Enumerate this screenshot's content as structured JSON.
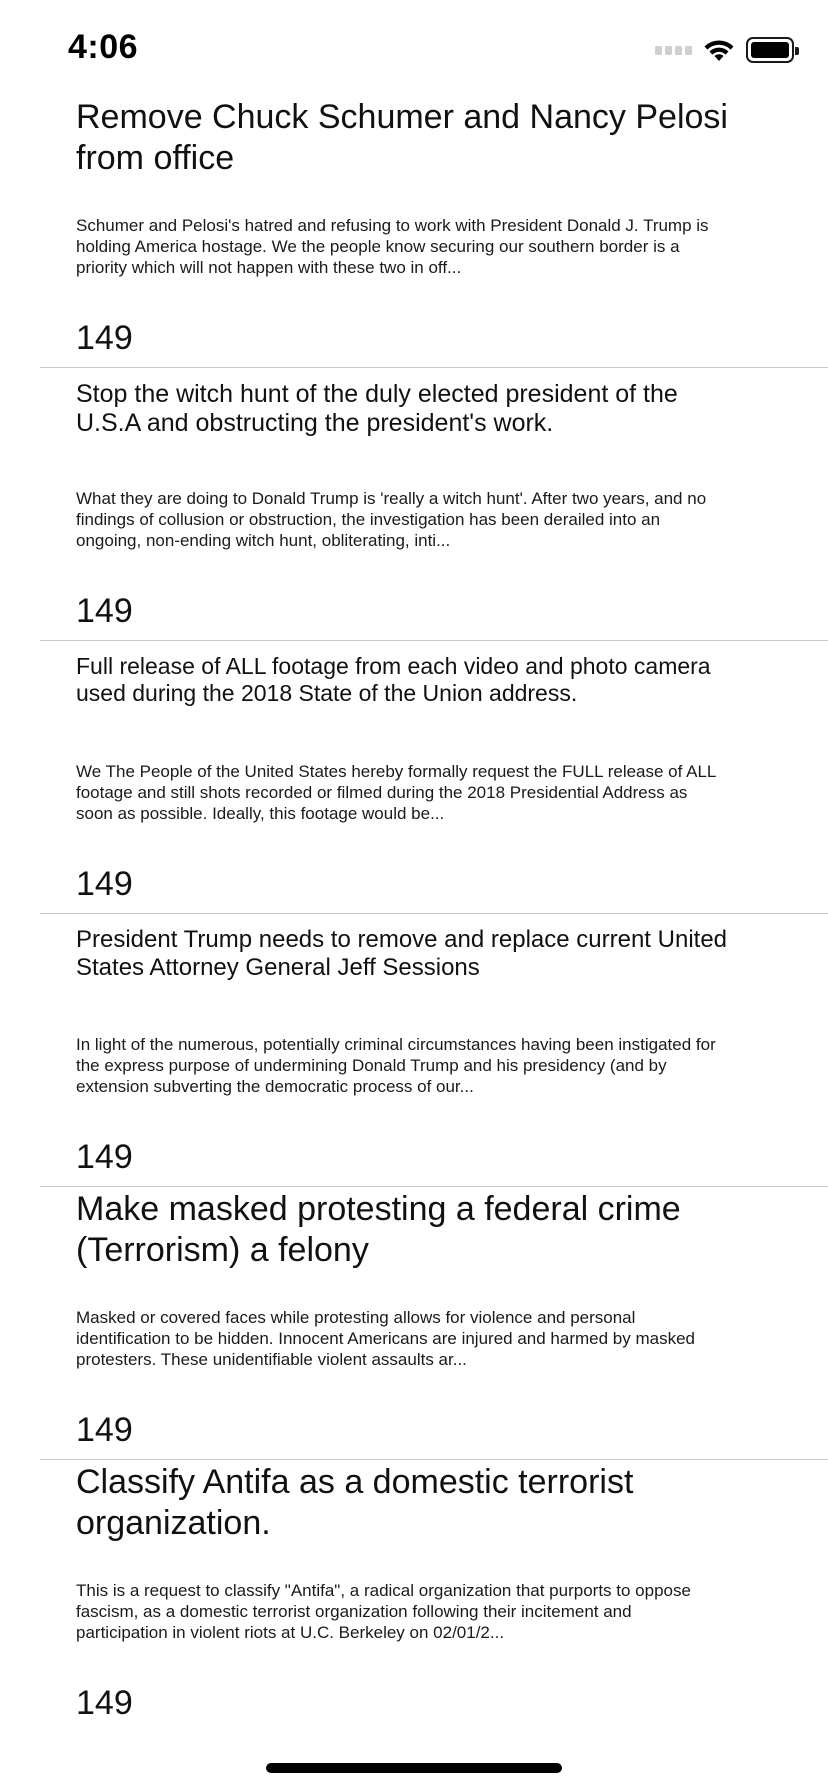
{
  "status_bar": {
    "time": "4:06",
    "icons": [
      "cellular-signal-icon",
      "wifi-icon",
      "battery-icon"
    ]
  },
  "petitions": [
    {
      "title": "Remove Chuck Schumer and Nancy Pelosi from office",
      "body": "Schumer and Pelosi's hatred and refusing to work with President Donald J. Trump is holding America hostage. We the people know securing our southern border is a priority which will not happen with these two in off...",
      "count": "149"
    },
    {
      "title": "Stop the witch hunt of the duly elected president of the U.S.A  and obstructing the president's work.",
      "body": "What they are doing to Donald Trump is 'really a witch hunt'.  After two years, and no findings of collusion or obstruction, the investigation has been derailed into an ongoing, non-ending witch hunt, obliterating,  inti...",
      "count": "149"
    },
    {
      "title": "Full release of ALL footage from each video and photo camera used during the 2018 State of the Union address.",
      "body": "We The People of the United States hereby formally request the FULL release of ALL footage and still shots recorded or filmed during the 2018 Presidential Address as soon as possible. Ideally, this footage would be...",
      "count": "149"
    },
    {
      "title": "President Trump needs to remove and replace current United States Attorney General Jeff Sessions",
      "body": "In light of the numerous, potentially criminal circumstances having been instigated for the express purpose of undermining Donald Trump and his presidency (and by extension subverting the democratic process of our...",
      "count": "149"
    },
    {
      "title": "Make masked protesting a federal crime (Terrorism) a felony",
      "body": "Masked or covered faces while protesting allows for violence and personal identification to be hidden. Innocent Americans are injured and harmed by masked protesters.  These unidentifiable violent assaults ar...",
      "count": "149"
    },
    {
      "title": "Classify Antifa as a domestic terrorist organization.",
      "body": "This is a request to classify \"Antifa\", a radical organization that purports to oppose fascism, as a domestic terrorist organization following their incitement and participation in violent riots at U.C. Berkeley on 02/01/2...",
      "count": "149"
    }
  ]
}
